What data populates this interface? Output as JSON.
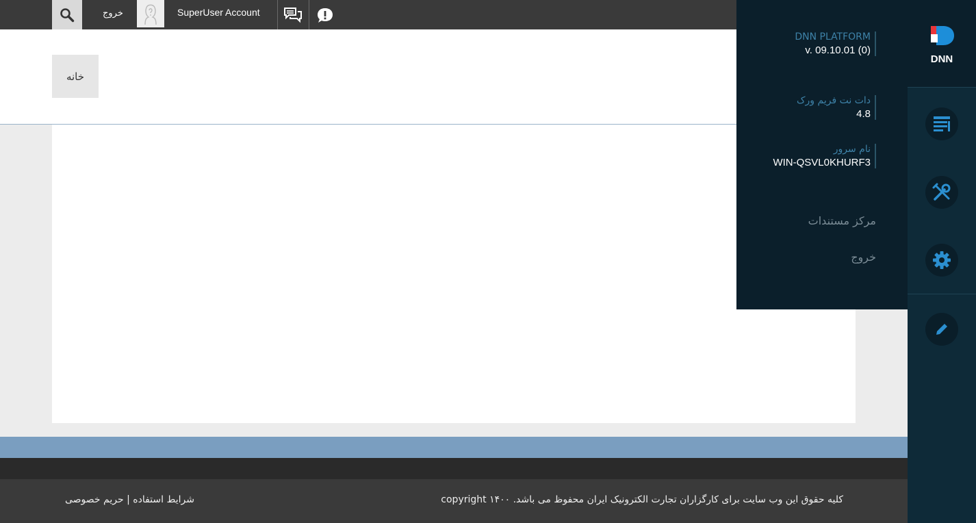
{
  "topbar": {
    "logout_label": "خروج",
    "username": "SuperUser Account",
    "icons": [
      "search-icon",
      "avatar",
      "messages-icon",
      "notifications-icon"
    ]
  },
  "header": {
    "home_label": "خانه"
  },
  "footer": {
    "copyright": "کلیه حقوق این وب سایت برای کارگزاران تجارت الکترونیک ایران محفوظ می باشد. copyright ۱۴۰۰",
    "terms_label": "شرایط استفاده",
    "separator": " | ",
    "privacy_label": "حریم خصوصی"
  },
  "flyout": {
    "platform_label": "DNN PLATFORM",
    "platform_version": "v. 09.10.01 (0)",
    "framework_label": "دات نت فریم ورک",
    "framework_value": "4.8",
    "server_label": "نام سرور",
    "server_value": "WIN-QSVL0KHURF3",
    "docs_link": "مرکز مستندات",
    "logout_link": "خروج"
  },
  "persona": {
    "logo_text": "DNN",
    "buttons": [
      "content-icon",
      "tools-icon",
      "settings-icon",
      "edit-icon"
    ]
  },
  "colors": {
    "persona_bg": "#0e2a38",
    "flyout_bg": "#0b1f2b",
    "accent_blue": "#3e82a8",
    "footer_blue": "#7a9ec0"
  }
}
